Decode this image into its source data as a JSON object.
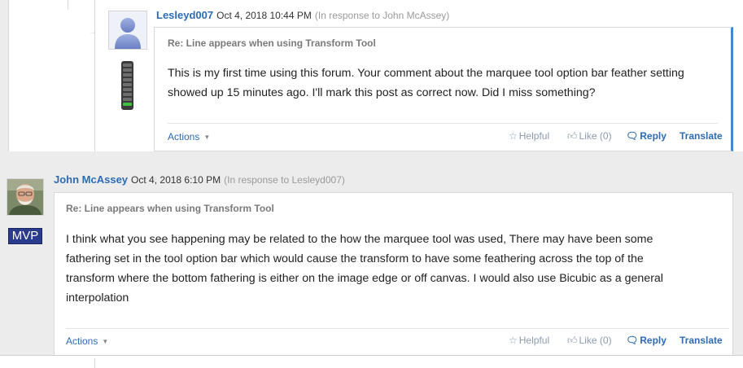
{
  "posts": [
    {
      "author": "Lesleyd007",
      "date": "Oct 4, 2018 10:44 PM",
      "in_response": "(In response to John McAssey)",
      "subject": "Re: Line appears when using Transform Tool",
      "body_lines": [
        "This is my first time using this forum. Your comment about the marquee tool option bar feather setting",
        "showed up 15 minutes ago. I'll mark this post as correct now. Did I miss something?"
      ],
      "actions_label": "Actions",
      "helpful_label": "Helpful",
      "like_label": "Like (0)",
      "reply_label": "Reply",
      "translate_label": "Translate",
      "rank_level": 1
    },
    {
      "author": "John McAssey",
      "date": "Oct 4, 2018 6:10 PM",
      "in_response": "(In response to Lesleyd007)",
      "subject": "Re: Line appears when using Transform Tool",
      "body_lines": [
        "I think what you see happening may be related to the how  the marquee tool was used,  There may have been some",
        "fathering set in the tool option bar which would cause the transform to have some feathering across the top of the",
        "transform where the bottom fathering is either on the image edge or off canvas.  I would also use Bicubic as a general",
        "interpolation"
      ],
      "badge": "MVP",
      "actions_label": "Actions",
      "helpful_label": "Helpful",
      "like_label": "Like (0)",
      "reply_label": "Reply",
      "translate_label": "Translate"
    }
  ],
  "colors": {
    "link": "#2d6bb5",
    "accent_border": "#3f87d8",
    "mvp_badge": "#2a3a8c",
    "rank_on": "#3fbf3f"
  },
  "icons": {
    "helpful": "star-outline-icon",
    "like": "thumbs-up-icon",
    "reply": "speech-bubble-icon",
    "actions": "caret-down-icon"
  }
}
